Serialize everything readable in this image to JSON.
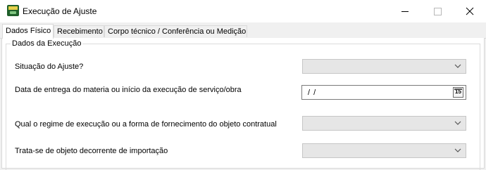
{
  "window": {
    "title": "Execução de Ajuste",
    "icon": "app-logo-icon",
    "controls": [
      "minimize",
      "maximize",
      "close"
    ]
  },
  "tabs": [
    {
      "label": "Dados Físico",
      "active": true
    },
    {
      "label": "Recebimento",
      "active": false
    },
    {
      "label": "Corpo técnico / Conferência ou Medição",
      "active": false
    }
  ],
  "group": {
    "title": "Dados da Execução"
  },
  "fields": {
    "situacao": {
      "label": "Situação do Ajuste?",
      "value": "",
      "type": "select"
    },
    "data_entrega": {
      "label": "Data de entrega do materia ou início da execução de serviço/obra",
      "value": "/ /",
      "button_text": "15",
      "type": "date"
    },
    "regime": {
      "label": "Qual o regime de execução ou a forma de fornecimento do objeto contratual",
      "value": "",
      "type": "select"
    },
    "importacao": {
      "label": "Trata-se de objeto decorrente de importação",
      "value": "",
      "type": "select"
    }
  },
  "colors": {
    "window_bg": "#f0f0f0",
    "panel_bg": "#ffffff",
    "disabled_combo": "#e6e6e6"
  }
}
